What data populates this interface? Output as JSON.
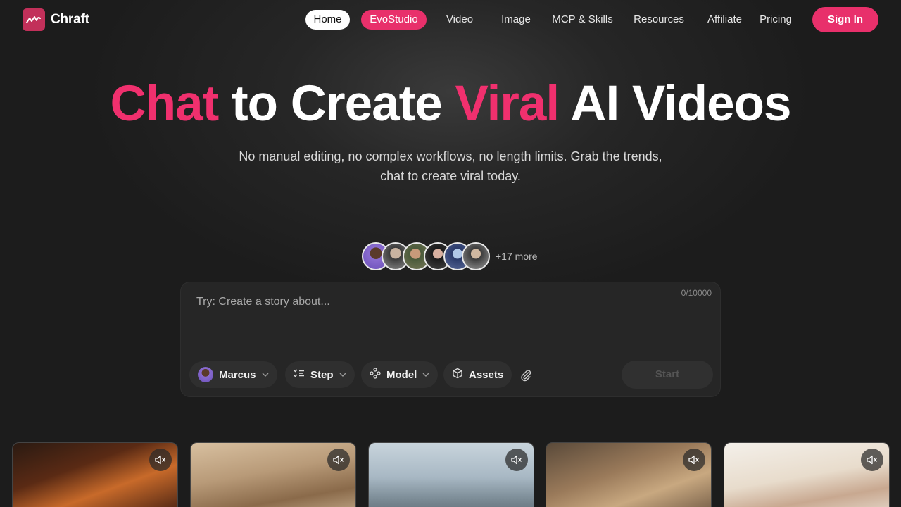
{
  "brand": {
    "name": "Chraft"
  },
  "nav": {
    "items": [
      {
        "label": "Home"
      },
      {
        "label": "EvoStudio"
      },
      {
        "label": "Video"
      },
      {
        "label": "Image"
      },
      {
        "label": "MCP & Skills"
      },
      {
        "label": "Resources"
      },
      {
        "label": "Affiliate"
      },
      {
        "label": "Pricing"
      }
    ],
    "signin_label": "Sign In"
  },
  "hero": {
    "title_parts": [
      "Chat",
      "to Create",
      "Viral",
      "AI Videos"
    ],
    "subtitle_line1": "No manual editing, no complex workflows, no length limits. Grab the trends,",
    "subtitle_line2": "chat to create viral today."
  },
  "social_proof": {
    "more_label": "+17 more"
  },
  "composer": {
    "counter": "0/10000",
    "placeholder": "Try: Create a story about...",
    "character_label": "Marcus",
    "step_label": "Step",
    "model_label": "Model",
    "assets_label": "Assets",
    "start_label": "Start"
  },
  "colors": {
    "accent": "#e8306b",
    "background": "#1c1c1c"
  }
}
